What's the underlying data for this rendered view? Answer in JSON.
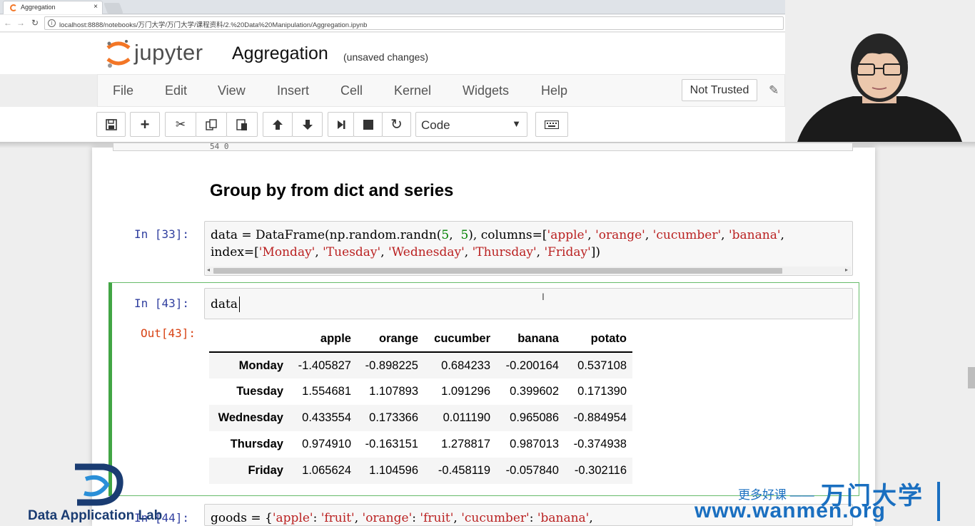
{
  "browser": {
    "tab_title": "Aggregation",
    "tab_close": "×",
    "url": "localhost:8888/notebooks/万门大学/万门大学/课程资料/2.%20Data%20Manipulation/Aggregation.ipynb"
  },
  "jupyter": {
    "logo_text": "jupyter",
    "notebook_name": "Aggregation",
    "save_status": "(unsaved changes)",
    "menu": [
      "File",
      "Edit",
      "View",
      "Insert",
      "Cell",
      "Kernel",
      "Widgets",
      "Help"
    ],
    "trust_label": "Not Trusted",
    "cell_type": "Code"
  },
  "notebook": {
    "prev_output_fragment": "54      0",
    "markdown_heading": "Group by from dict and series",
    "cell33": {
      "prompt": "In  [33]:",
      "code_line1": {
        "a": "data = DataFrame(np.random.randn(",
        "n1": "5",
        "b": ",  ",
        "n2": "5",
        "c": "), columns=[",
        "s1": "'apple'",
        "d": ", ",
        "s2": "'orange'",
        "e": ", ",
        "s3": "'cucumber'",
        "f": ", ",
        "s4": "'banana'",
        "g": ","
      },
      "code_line2": {
        "a": "index=[",
        "s1": "'Monday'",
        "b": ", ",
        "s2": "'Tuesday'",
        "c": ", ",
        "s3": "'Wednesday'",
        "d": ", ",
        "s4": "'Thursday'",
        "e": ", ",
        "s5": "'Friday'",
        "f": "])"
      }
    },
    "cell43": {
      "in_prompt": "In  [43]:",
      "code": "data",
      "out_prompt": "Out[43]:",
      "table": {
        "columns": [
          "apple",
          "orange",
          "cucumber",
          "banana",
          "potato"
        ],
        "rows": [
          {
            "index": "Monday",
            "values": [
              "-1.405827",
              "-0.898225",
              "0.684233",
              "-0.200164",
              "0.537108"
            ]
          },
          {
            "index": "Tuesday",
            "values": [
              "1.554681",
              "1.107893",
              "1.091296",
              "0.399602",
              "0.171390"
            ]
          },
          {
            "index": "Wednesday",
            "values": [
              "0.433554",
              "0.173366",
              "0.011190",
              "0.965086",
              "-0.884954"
            ]
          },
          {
            "index": "Thursday",
            "values": [
              "0.974910",
              "-0.163151",
              "1.278817",
              "0.987013",
              "-0.374938"
            ]
          },
          {
            "index": "Friday",
            "values": [
              "1.065624",
              "1.104596",
              "-0.458119",
              "-0.057840",
              "-0.302116"
            ]
          }
        ]
      }
    },
    "cell44": {
      "prompt": "In  [44]:",
      "code": {
        "a": "goods = {",
        "s1": "'apple'",
        "b": ": ",
        "s2": "'fruit'",
        "c": ", ",
        "s3": "'orange'",
        "d": ": ",
        "s4": "'fruit'",
        "e": ", ",
        "s5": "'cucumber'",
        "f": ": ",
        "s6": "'banana'",
        "g": ", "
      }
    }
  },
  "watermark": {
    "left_logo_text": "Data Application Lab",
    "right_slogan": "更多好课 ——",
    "right_brand": "万门大学",
    "right_url": "www.wanmen.org"
  },
  "colors": {
    "selected_cell_border": "#42a545",
    "in_prompt": "#303f9f",
    "out_prompt": "#d84315",
    "string_literal": "#ba2121",
    "number_literal": "#008000",
    "watermark_blue": "#1a6fc0"
  }
}
